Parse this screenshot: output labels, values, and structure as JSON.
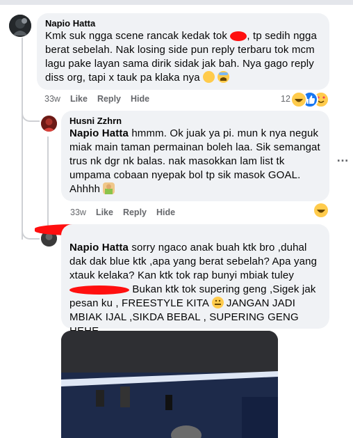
{
  "comment1": {
    "author": "Napio Hatta",
    "text_part1": "Kmk suk ngga scene rancak kedak tok ",
    "text_part2": ", tp sedih ngga berat sebelah. Nak losing side pun reply terbaru tok mcm lagu pake layan sama dirik sidak jak bah. Nya gago reply diss org, tapi x tauk pa klaka nya ",
    "time": "33w",
    "like": "Like",
    "reply": "Reply",
    "hide": "Hide",
    "reaction_count": "12"
  },
  "reply1": {
    "author": "Husni Zzhrn",
    "mention": "Napio Hatta",
    "text": " hmmm. Ok juak ya pi. mun k nya neguk miak main taman permainan boleh laa. Sik semangat trus nk dgr nk balas. nak masokkan lam list tk umpama cobaan nyepak bol tp sik masok GOAL. Ahhhh ",
    "time": "33w",
    "like": "Like",
    "reply": "Reply",
    "hide": "Hide"
  },
  "reply2": {
    "mention": "Napio Hatta",
    "text_part1": " sorry ngaco anak buah ktk bro ,duhal dak dak blue ktk ,apa yang berat sebelah? Apa yang xtauk kelaka? Kan ktk tok rap bunyi mbiak tuley ",
    "text_part2": " Bukan ktk tok supering geng ,Sigek jak pesan ku , FREESTYLE KITA ",
    "text_part3": " JANGAN JADI MBIAK IJAL ,SIKDA BEBAL , SUPERING GENG HEHE"
  },
  "more_label": "…"
}
